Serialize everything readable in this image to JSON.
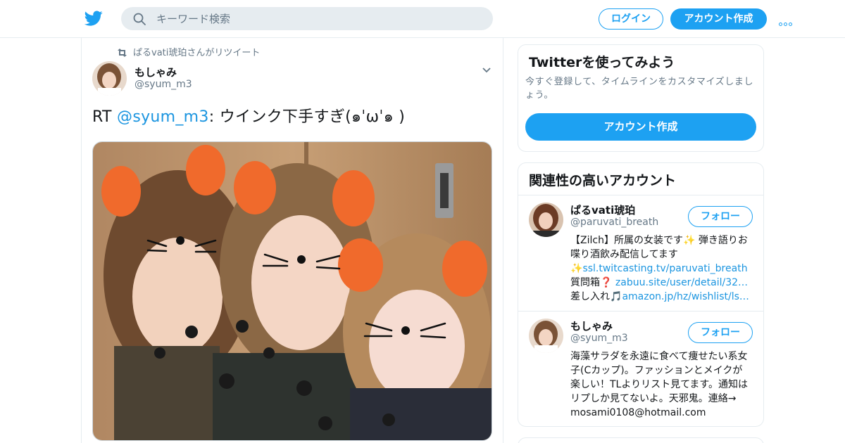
{
  "header": {
    "logo_icon": "twitter-bird-icon",
    "search_placeholder": "キーワード検索",
    "login_label": "ログイン",
    "signup_label": "アカウント作成",
    "more_icon": "more-dots-icon",
    "accent_color": "#1da1f2"
  },
  "tweet": {
    "retweet_context": "ぱるvati琥珀さんがリツイート",
    "author_name": "もしゃみ ",
    "author_handle": "@syum_m3",
    "text_prefix": "RT ",
    "text_mention": "@syum_m3",
    "text_rest": ": ウインク下手すぎ(๑ˈωˈ๑ )",
    "photo_icon": "photo-image"
  },
  "sidebar": {
    "signup_module": {
      "title": "Twitterを使ってみよう",
      "description": "今すぐ登録して、タイムラインをカスタマイズしましょう。",
      "button_label": "アカウント作成"
    },
    "related": {
      "title": "関連性の高いアカウント",
      "follow_label": "フォロー",
      "accounts": [
        {
          "name": "ぱるvati琥珀",
          "handle": "@paruvati_breath",
          "bio_1": "【Zilch】所属の女装です✨ 弾き語りお喋り酒飲み配信してます✨",
          "bio_link_1": "ssl.twitcasting.tv/paruvati_breath",
          "bio_2": " 　質問箱❓ ",
          "bio_link_2": "zabuu.site/user/detail/32…",
          "bio_3": " 差し入れ🎵",
          "bio_link_3": "amazon.jp/hz/wishlist/ls…"
        },
        {
          "name": "もしゃみ ",
          "handle": "@syum_m3",
          "bio_1": "海藻サラダを永遠に食べて痩せたい系女子(Cカップ)。ファッションとメイクが楽しい！TLよりリスト見てます。通知はリプしか見てないよ。天邪鬼。連絡→ mosami0108@hotmail.com"
        }
      ]
    }
  }
}
